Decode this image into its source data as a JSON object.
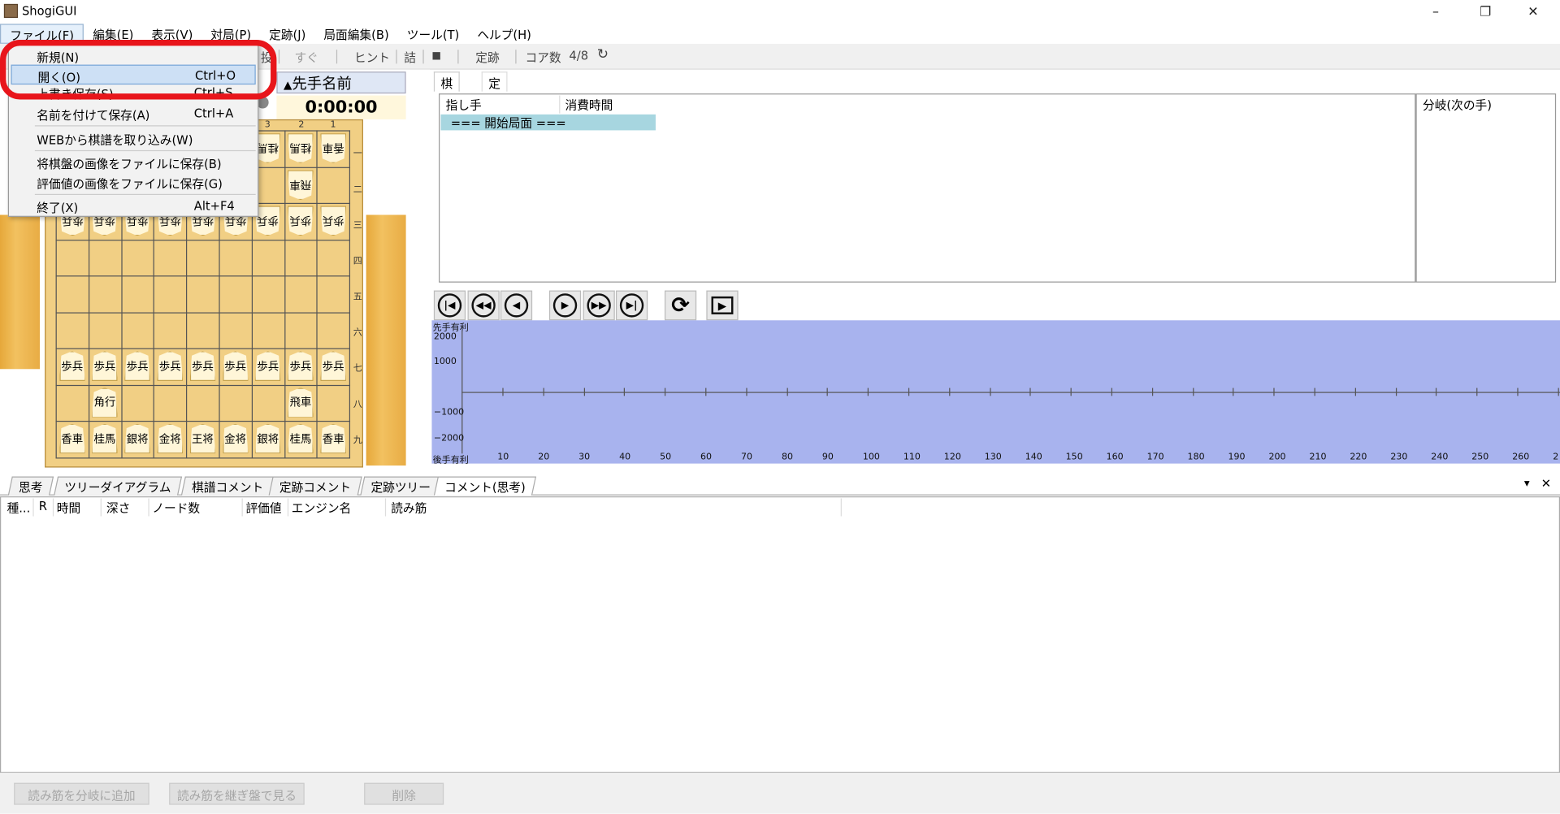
{
  "window": {
    "title": "ShogiGUI",
    "minimize": "–",
    "restore": "❐",
    "close": "✕"
  },
  "menubar": [
    "ファイル(F)",
    "編集(E)",
    "表示(V)",
    "対局(P)",
    "定跡(J)",
    "局面編集(B)",
    "ツール(T)",
    "ヘルプ(H)"
  ],
  "file_menu": {
    "new": "新規(N)",
    "open": "開く(O)",
    "open_shortcut": "Ctrl+O",
    "overwrite": "上書き保存(S)",
    "overwrite_shortcut": "Ctrl+S",
    "save_as": "名前を付けて保存(A)",
    "save_as_shortcut": "Ctrl+A",
    "import_web": "WEBから棋譜を取り込み(W)",
    "save_board_img": "将棋盤の画像をファイルに保存(B)",
    "save_eval_img": "評価値の画像をファイルに保存(G)",
    "exit": "終了(X)",
    "exit_shortcut": "Alt+F4"
  },
  "toolbar": {
    "resign_partial": "投",
    "now": "すぐ",
    "hint": "ヒント",
    "mate": "詰",
    "stop": "■",
    "joseki": "定跡",
    "cores_label": "コア数",
    "cores_value": "4/8"
  },
  "player": {
    "sente_name": "先手名前",
    "clock": "0:00:00"
  },
  "board": {
    "file_labels": [
      "3",
      "2",
      "1"
    ],
    "rank_labels": [
      "一",
      "二",
      "三",
      "四",
      "五",
      "六",
      "七",
      "八",
      "九"
    ],
    "pieces_top": [
      "桂馬",
      "香車",
      "飛車"
    ],
    "pieces_gote_row3": [
      "歩兵",
      "歩兵",
      "歩兵",
      "歩兵",
      "歩兵",
      "歩兵",
      "歩兵",
      "歩兵",
      "歩兵"
    ],
    "pieces_sente_row7": [
      "歩兵",
      "歩兵",
      "歩兵",
      "歩兵",
      "歩兵",
      "歩兵",
      "歩兵",
      "歩兵",
      "歩兵"
    ],
    "pieces_row8": [
      "角行",
      "飛車"
    ],
    "pieces_row9": [
      "香車",
      "桂馬",
      "銀将",
      "金将",
      "王将",
      "金将",
      "銀将",
      "桂馬",
      "香車"
    ]
  },
  "kifu": {
    "tab_kifu": "棋譜",
    "tab_joseki": "定跡",
    "col_move": "指し手",
    "col_time": "消費時間",
    "start_row": "=== 開始局面 ===",
    "branch_header": "分岐(次の手)"
  },
  "chart": {
    "type": "line",
    "top_label": "先手有利",
    "bottom_label": "後手有利",
    "y_ticks": [
      "2000",
      "1000",
      "−1000",
      "−2000"
    ],
    "x_ticks": [
      "10",
      "20",
      "30",
      "40",
      "50",
      "60",
      "70",
      "80",
      "90",
      "100",
      "110",
      "120",
      "130",
      "140",
      "150",
      "160",
      "170",
      "180",
      "190",
      "200",
      "210",
      "220",
      "230",
      "240",
      "250",
      "260",
      "2"
    ],
    "series": [],
    "background": "#a8b3ee"
  },
  "bottom_tabs": [
    "思考",
    "ツリーダイアグラム",
    "棋譜コメント",
    "定跡コメント",
    "定跡ツリー",
    "コメント(思考)"
  ],
  "bottom_tab_controls": {
    "dropdown": "▾",
    "close": "✕"
  },
  "think_columns": [
    "種...",
    "R",
    "時間",
    "深さ",
    "ノード数",
    "評価値",
    "エンジン名",
    "読み筋"
  ],
  "buttons": {
    "add_branch": "読み筋を分岐に追加",
    "view_continued": "読み筋を継ぎ盤で見る",
    "delete": "削除"
  },
  "colors": {
    "highlight_ring": "#e8151b",
    "menu_highlight": "#cde0f5",
    "kifu_row": "#a7d6e0"
  }
}
